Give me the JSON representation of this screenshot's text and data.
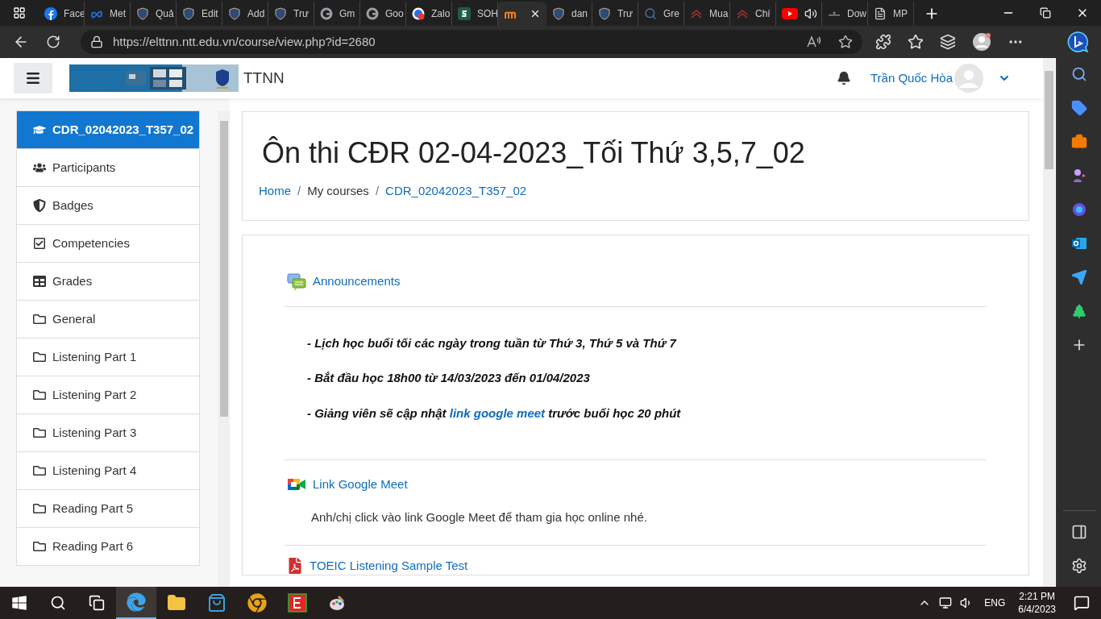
{
  "browser": {
    "tabs": [
      {
        "kind": "facebook",
        "title": "Face",
        "selected": false
      },
      {
        "kind": "meta",
        "title": "Met",
        "selected": false
      },
      {
        "kind": "shield",
        "title": "Quả",
        "selected": false
      },
      {
        "kind": "shield",
        "title": "Edit",
        "selected": false
      },
      {
        "kind": "shield",
        "title": "Add",
        "selected": false
      },
      {
        "kind": "shield",
        "title": "Trư",
        "selected": false
      },
      {
        "kind": "google",
        "title": "Gm",
        "selected": false
      },
      {
        "kind": "google",
        "title": "Goo",
        "selected": false
      },
      {
        "kind": "zalo",
        "title": "Zalo",
        "selected": false
      },
      {
        "kind": "square",
        "title": "SOH",
        "selected": false
      },
      {
        "kind": "moodle",
        "selected": true
      },
      {
        "kind": "shield",
        "title": "dan",
        "selected": false
      },
      {
        "kind": "shield",
        "title": "Trư",
        "selected": false
      },
      {
        "kind": "search",
        "title": "Gre",
        "selected": false
      },
      {
        "kind": "chevrons",
        "title": "Mua",
        "selected": false
      },
      {
        "kind": "chevrons",
        "title": "Chí",
        "selected": false
      },
      {
        "kind": "youtube",
        "selected": false
      },
      {
        "kind": "download",
        "title": "Dow",
        "selected": false
      },
      {
        "kind": "page",
        "title": "MP",
        "selected": false
      }
    ],
    "url": "https://elttnn.ntt.edu.vn/course/view.php?id=2680"
  },
  "navbar": {
    "site_name": "TTNN",
    "user_name": "Trần Quốc Hòa"
  },
  "drawer": {
    "items": [
      {
        "kind": "course",
        "label": "CDR_02042023_T357_02",
        "selected": true
      },
      {
        "kind": "participants",
        "label": "Participants",
        "selected": false
      },
      {
        "kind": "badges",
        "label": "Badges",
        "selected": false
      },
      {
        "kind": "competencies",
        "label": "Competencies",
        "selected": false
      },
      {
        "kind": "grades",
        "label": "Grades",
        "selected": false
      },
      {
        "kind": "section",
        "label": "General",
        "selected": false
      },
      {
        "kind": "section",
        "label": "Listening Part 1",
        "selected": false
      },
      {
        "kind": "section",
        "label": "Listening Part 2",
        "selected": false
      },
      {
        "kind": "section",
        "label": "Listening Part 3",
        "selected": false
      },
      {
        "kind": "section",
        "label": "Listening Part 4",
        "selected": false
      },
      {
        "kind": "section",
        "label": "Reading Part 5",
        "selected": false
      },
      {
        "kind": "section",
        "label": "Reading Part 6",
        "selected": false
      }
    ]
  },
  "header": {
    "title": "Ôn thi CĐR 02-04-2023_Tối Thứ 3,5,7_02",
    "separator": "/",
    "breadcrumb": [
      {
        "label": "Home",
        "link": true
      },
      {
        "label": "My courses",
        "link": false
      },
      {
        "label": "CDR_02042023_T357_02",
        "link": true
      }
    ]
  },
  "activities": [
    {
      "kind": "forum",
      "name": "Announcements",
      "lines": [
        [
          {
            "text": "- Lịch học buổi tối các ngày trong tuần từ Thứ 3, Thứ 5 và Thứ 7",
            "link": false
          }
        ],
        [
          {
            "text": "- Bắt đầu học 18h00 từ 14/03/2023 đến 01/04/2023",
            "link": false
          }
        ],
        [
          {
            "text": "- Giảng viên sẽ cập nhật ",
            "link": false
          },
          {
            "text": "link google meet",
            "link": true
          },
          {
            "text": " trước buổi học 20 phút",
            "link": false
          }
        ]
      ]
    },
    {
      "kind": "meet",
      "name": "Link Google Meet",
      "description": "Anh/chị click vào link Google Meet để tham gia học online nhé."
    },
    {
      "kind": "pdf",
      "name": "TOEIC Listening Sample Test"
    }
  ],
  "taskbar": {
    "apps": [
      {
        "kind": "edge",
        "selected": true
      },
      {
        "kind": "explorer",
        "selected": false
      },
      {
        "kind": "store",
        "selected": false
      },
      {
        "kind": "chrome",
        "selected": false
      },
      {
        "kind": "redapp",
        "selected": false
      },
      {
        "kind": "paint",
        "selected": false
      }
    ],
    "language": "ENG",
    "time": "2:21 PM",
    "date": "6/4/2023"
  }
}
